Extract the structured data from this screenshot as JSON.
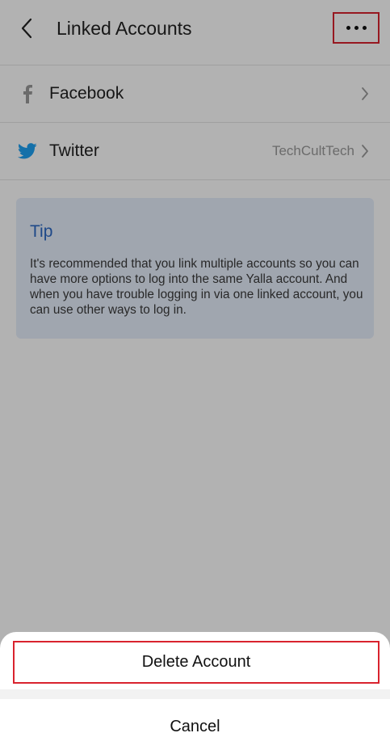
{
  "header": {
    "title": "Linked Accounts",
    "back_icon": "chevron-left-icon",
    "more_icon": "more-horizontal-icon"
  },
  "accounts": [
    {
      "label": "Facebook",
      "icon": "facebook-icon",
      "value": "",
      "chevron": "chevron-right-icon"
    },
    {
      "label": "Twitter",
      "icon": "twitter-icon",
      "value": "TechCultTech",
      "chevron": "chevron-right-icon"
    }
  ],
  "tip": {
    "title": "Tip",
    "text": "It's recommended that you link multiple accounts so you can have more options to log into the same Yalla account. And when you have trouble logging in via one linked account, you can use other ways to log in."
  },
  "sheet": {
    "delete_label": "Delete Account",
    "cancel_label": "Cancel"
  },
  "colors": {
    "highlight": "#d9232e",
    "tip_title": "#2d69c4",
    "twitter": "#1da1f2"
  }
}
